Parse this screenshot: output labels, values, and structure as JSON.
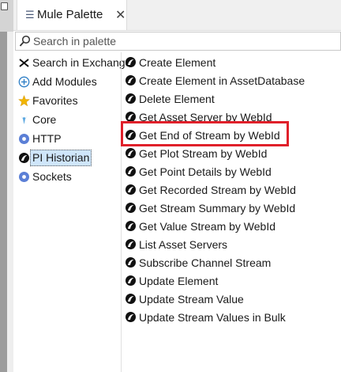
{
  "tab": {
    "label": "Mule Palette",
    "close": "✕"
  },
  "search": {
    "placeholder": "Search in palette"
  },
  "modules": [
    {
      "label": "Search in Exchange",
      "icon": "exchange-icon"
    },
    {
      "label": "Add Modules",
      "icon": "plus-circle-icon"
    },
    {
      "label": "Favorites",
      "icon": "star-icon"
    },
    {
      "label": "Core",
      "icon": "core-icon"
    },
    {
      "label": "HTTP",
      "icon": "http-icon"
    },
    {
      "label": "PI Historian",
      "icon": "pi-historian-icon",
      "selected": true
    },
    {
      "label": "Sockets",
      "icon": "sockets-icon"
    }
  ],
  "operations": [
    "Create Element",
    "Create Element in AssetDatabase",
    "Delete Element",
    "Get Asset Server by WebId",
    "Get End of Stream by WebId",
    "Get Plot Stream by WebId",
    "Get Point Details by WebId",
    "Get Recorded Stream by WebId",
    "Get Stream Summary by WebId",
    "Get Value Stream by WebId",
    "List Asset Servers",
    "Subscribe Channel Stream",
    "Update Element",
    "Update Stream Value",
    "Update Stream Values in Bulk"
  ],
  "highlighted_operation": "Get End of Stream by WebId",
  "colors": {
    "highlight": "#e0202a",
    "selected_bg": "#cfe6fb"
  }
}
